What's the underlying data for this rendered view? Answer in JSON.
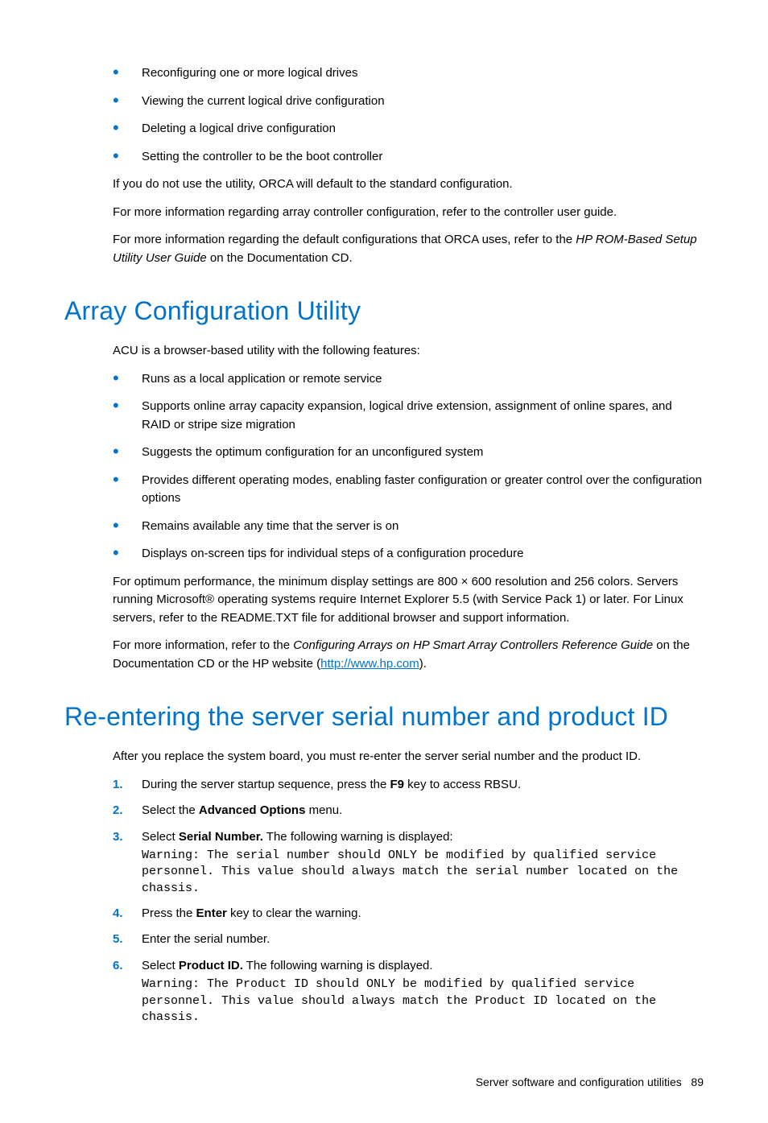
{
  "lead_bullets": {
    "items": [
      "Reconfiguring one or more logical drives",
      "Viewing the current logical drive configuration",
      "Deleting a logical drive configuration",
      "Setting the controller to be the boot controller"
    ]
  },
  "lead_paras": {
    "p1": "If you do not use the utility, ORCA will default to the standard configuration.",
    "p2": "For more information regarding array controller configuration, refer to the controller user guide.",
    "p3a": "For more information regarding the default configurations that ORCA uses, refer to the ",
    "p3b": "HP ROM-Based Setup Utility User Guide",
    "p3c": " on the Documentation CD."
  },
  "acu": {
    "heading": "Array Configuration Utility",
    "intro": "ACU is a browser-based utility with the following features:",
    "bullets": [
      "Runs as a local application or remote service",
      "Supports online array capacity expansion, logical drive extension, assignment of online spares, and RAID or stripe size migration",
      "Suggests the optimum configuration for an unconfigured system",
      "Provides different operating modes, enabling faster configuration or greater control over the configuration options",
      "Remains available any time that the server is on",
      "Displays on-screen tips for individual steps of a configuration procedure"
    ],
    "p1": "For optimum performance, the minimum display settings are 800 × 600 resolution and 256 colors. Servers running Microsoft® operating systems require Internet Explorer 5.5 (with Service Pack 1) or later. For Linux servers, refer to the README.TXT file for additional browser and support information.",
    "p2a": "For more information, refer to the ",
    "p2b": "Configuring Arrays on HP Smart Array Controllers Reference Guide",
    "p2c": " on the Documentation CD or the HP website (",
    "p2link": "http://www.hp.com",
    "p2d": ")."
  },
  "reenter": {
    "heading": "Re-entering the server serial number and product ID",
    "intro": "After you replace the system board, you must re-enter the server serial number and the product ID.",
    "steps": {
      "s1a": "During the server startup sequence, press the ",
      "s1b": "F9",
      "s1c": " key to access RBSU.",
      "s2a": "Select the ",
      "s2b": "Advanced Options",
      "s2c": " menu.",
      "s3a": "Select ",
      "s3b": "Serial Number.",
      "s3c": " The following warning is displayed:",
      "s3code": "Warning: The serial number should ONLY be modified by qualified service personnel. This value should always match the serial number located on the chassis.",
      "s4a": "Press the ",
      "s4b": "Enter",
      "s4c": " key to clear the warning.",
      "s5": "Enter the serial number.",
      "s6a": "Select ",
      "s6b": "Product ID.",
      "s6c": " The following warning is displayed.",
      "s6code": "Warning: The Product ID should ONLY be modified by qualified service personnel. This value should always match the Product ID located on the chassis."
    }
  },
  "footer": {
    "section": "Server software and configuration utilities",
    "page": "89"
  }
}
